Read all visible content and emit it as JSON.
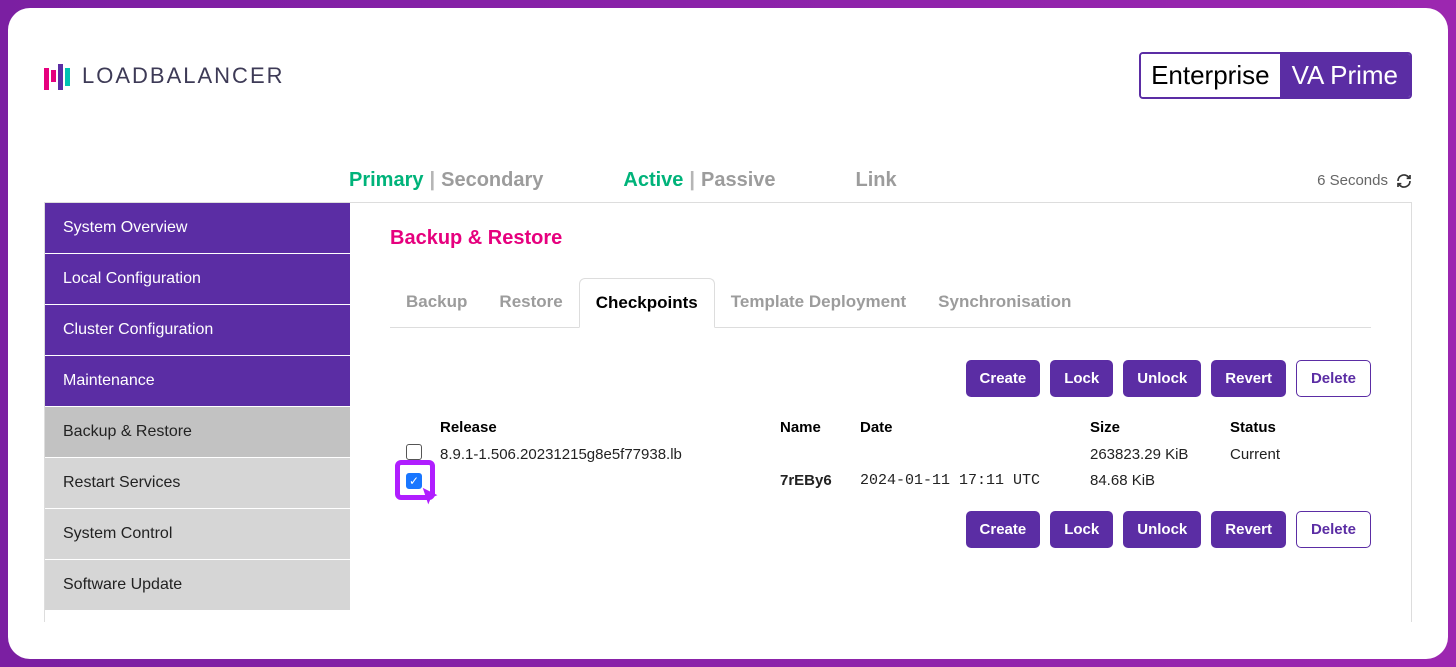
{
  "header": {
    "brand": "LOADBALANCER",
    "product": {
      "enterprise": "Enterprise",
      "variant": "VA Prime"
    }
  },
  "status": {
    "primary": "Primary",
    "secondary": "Secondary",
    "active": "Active",
    "passive": "Passive",
    "link": "Link",
    "refresh": "6 Seconds"
  },
  "sidebar": {
    "items": [
      {
        "label": "System Overview",
        "style": "purple"
      },
      {
        "label": "Local Configuration",
        "style": "purple"
      },
      {
        "label": "Cluster Configuration",
        "style": "purple"
      },
      {
        "label": "Maintenance",
        "style": "purple"
      },
      {
        "label": "Backup & Restore",
        "style": "active-sub"
      },
      {
        "label": "Restart Services",
        "style": "gray"
      },
      {
        "label": "System Control",
        "style": "gray"
      },
      {
        "label": "Software Update",
        "style": "gray"
      }
    ]
  },
  "page": {
    "title": "Backup & Restore",
    "tabs": [
      {
        "label": "Backup"
      },
      {
        "label": "Restore"
      },
      {
        "label": "Checkpoints",
        "active": true
      },
      {
        "label": "Template Deployment"
      },
      {
        "label": "Synchronisation"
      }
    ],
    "actions": {
      "create": "Create",
      "lock": "Lock",
      "unlock": "Unlock",
      "revert": "Revert",
      "delete": "Delete"
    },
    "table": {
      "headers": {
        "release": "Release",
        "name": "Name",
        "date": "Date",
        "size": "Size",
        "status": "Status"
      },
      "rows": [
        {
          "checked": false,
          "release": "8.9.1-1.506.20231215g8e5f77938.lb",
          "name": "",
          "date": "",
          "size": "263823.29 KiB",
          "status": "Current"
        },
        {
          "checked": true,
          "release": "",
          "name": "7rEBy6",
          "date": "2024-01-11 17:11 UTC",
          "size": "84.68 KiB",
          "status": ""
        }
      ]
    }
  }
}
